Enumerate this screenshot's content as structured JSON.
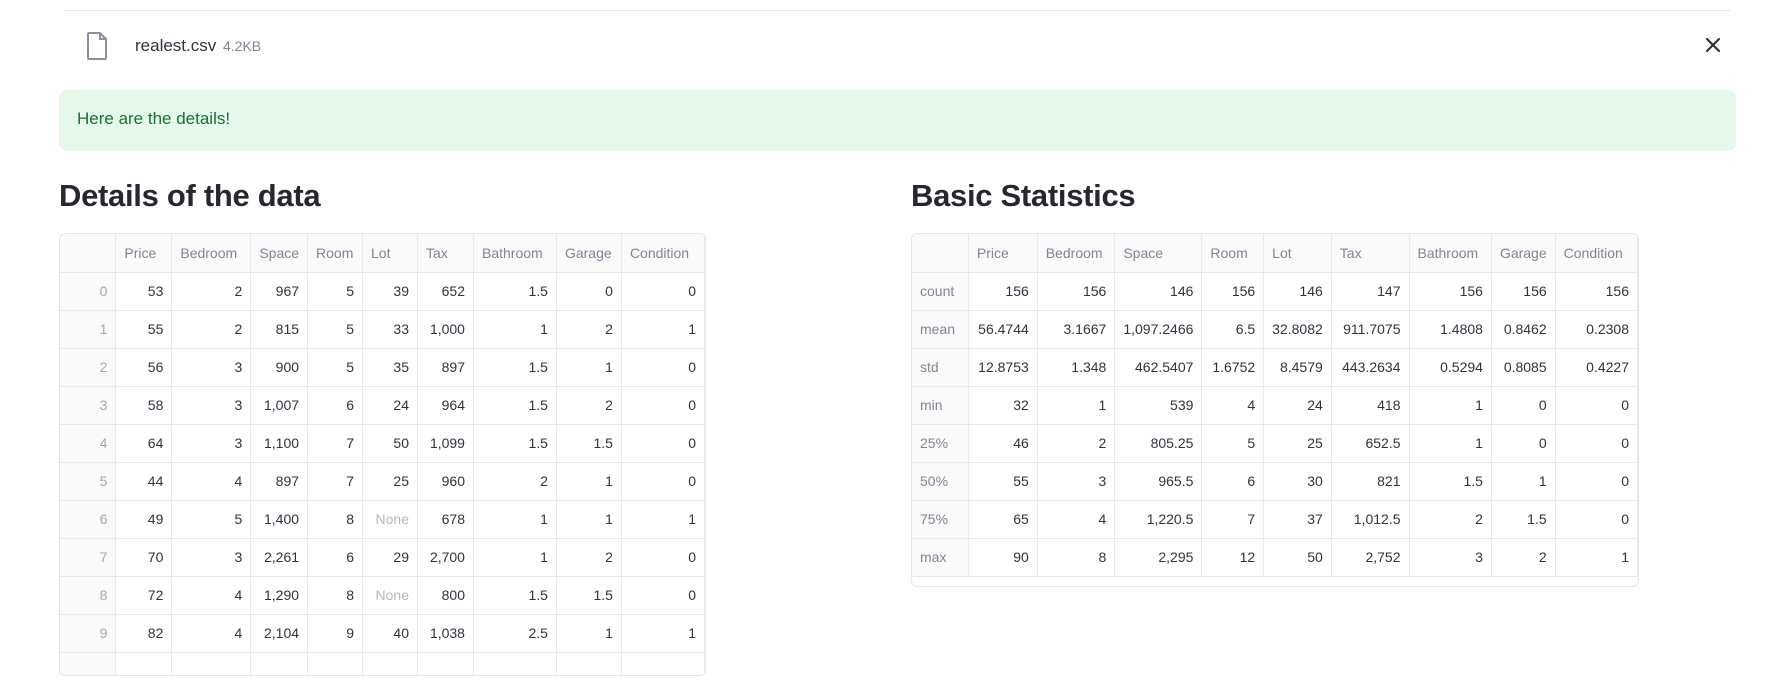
{
  "file": {
    "icon": "file-icon",
    "name": "realest.csv",
    "size": "4.2KB",
    "close_icon": "close-icon"
  },
  "alert": {
    "message": "Here are the details!"
  },
  "details": {
    "title": "Details of the data",
    "columns": [
      "",
      "Price",
      "Bedroom",
      "Space",
      "Room",
      "Lot",
      "Tax",
      "Bathroom",
      "Garage",
      "Condition"
    ],
    "rows": [
      [
        "0",
        "53",
        "2",
        "967",
        "5",
        "39",
        "652",
        "1.5",
        "0",
        "0"
      ],
      [
        "1",
        "55",
        "2",
        "815",
        "5",
        "33",
        "1,000",
        "1",
        "2",
        "1"
      ],
      [
        "2",
        "56",
        "3",
        "900",
        "5",
        "35",
        "897",
        "1.5",
        "1",
        "0"
      ],
      [
        "3",
        "58",
        "3",
        "1,007",
        "6",
        "24",
        "964",
        "1.5",
        "2",
        "0"
      ],
      [
        "4",
        "64",
        "3",
        "1,100",
        "7",
        "50",
        "1,099",
        "1.5",
        "1.5",
        "0"
      ],
      [
        "5",
        "44",
        "4",
        "897",
        "7",
        "25",
        "960",
        "2",
        "1",
        "0"
      ],
      [
        "6",
        "49",
        "5",
        "1,400",
        "8",
        "None",
        "678",
        "1",
        "1",
        "1"
      ],
      [
        "7",
        "70",
        "3",
        "2,261",
        "6",
        "29",
        "2,700",
        "1",
        "2",
        "0"
      ],
      [
        "8",
        "72",
        "4",
        "1,290",
        "8",
        "None",
        "800",
        "1.5",
        "1.5",
        "0"
      ],
      [
        "9",
        "82",
        "4",
        "2,104",
        "9",
        "40",
        "1,038",
        "2.5",
        "1",
        "1"
      ]
    ]
  },
  "stats": {
    "title": "Basic Statistics",
    "columns": [
      "",
      "Price",
      "Bedroom",
      "Space",
      "Room",
      "Lot",
      "Tax",
      "Bathroom",
      "Garage",
      "Condition"
    ],
    "rows": [
      [
        "count",
        "156",
        "156",
        "146",
        "156",
        "146",
        "147",
        "156",
        "156",
        "156"
      ],
      [
        "mean",
        "56.4744",
        "3.1667",
        "1,097.2466",
        "6.5",
        "32.8082",
        "911.7075",
        "1.4808",
        "0.8462",
        "0.2308"
      ],
      [
        "std",
        "12.8753",
        "1.348",
        "462.5407",
        "1.6752",
        "8.4579",
        "443.2634",
        "0.5294",
        "0.8085",
        "0.4227"
      ],
      [
        "min",
        "32",
        "1",
        "539",
        "4",
        "24",
        "418",
        "1",
        "0",
        "0"
      ],
      [
        "25%",
        "46",
        "2",
        "805.25",
        "5",
        "25",
        "652.5",
        "1",
        "0",
        "0"
      ],
      [
        "50%",
        "55",
        "3",
        "965.5",
        "6",
        "30",
        "821",
        "1.5",
        "1",
        "0"
      ],
      [
        "75%",
        "65",
        "4",
        "1,220.5",
        "7",
        "37",
        "1,012.5",
        "2",
        "1.5",
        "0"
      ],
      [
        "max",
        "90",
        "8",
        "2,295",
        "12",
        "50",
        "2,752",
        "3",
        "2",
        "1"
      ]
    ]
  }
}
